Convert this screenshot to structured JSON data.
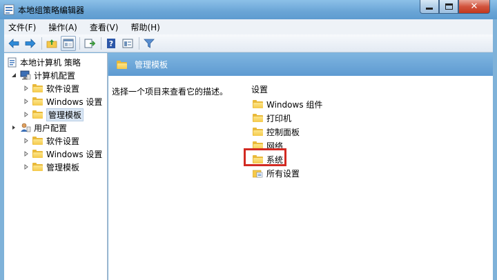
{
  "window": {
    "title": "本地组策略编辑器",
    "controls": {
      "close_glyph": "✕"
    }
  },
  "menubar": {
    "items": [
      "文件(F)",
      "操作(A)",
      "查看(V)",
      "帮助(H)"
    ]
  },
  "toolbar": {
    "buttons": [
      "back-arrow-icon",
      "forward-arrow-icon",
      "up-folder-icon",
      "show-hide-tree-icon",
      "export-list-icon",
      "help-icon",
      "properties-icon",
      "filter-icon"
    ]
  },
  "tree": {
    "root": "本地计算机 策略",
    "computer_config": "计算机配置",
    "computer_children": [
      "软件设置",
      "Windows 设置",
      "管理模板"
    ],
    "user_config": "用户配置",
    "user_children": [
      "软件设置",
      "Windows 设置",
      "管理模板"
    ]
  },
  "content": {
    "header_title": "管理模板",
    "description": "选择一个项目来查看它的描述。",
    "settings_header": "设置",
    "items": [
      "Windows 组件",
      "打印机",
      "控制面板",
      "网络",
      "系统",
      "所有设置"
    ],
    "highlighted_item": "系统"
  },
  "colors": {
    "title_bar": "#6aa5d6",
    "header_band": "#5e9ad1",
    "folder": "#f5c94a",
    "highlight": "#d22a22"
  }
}
